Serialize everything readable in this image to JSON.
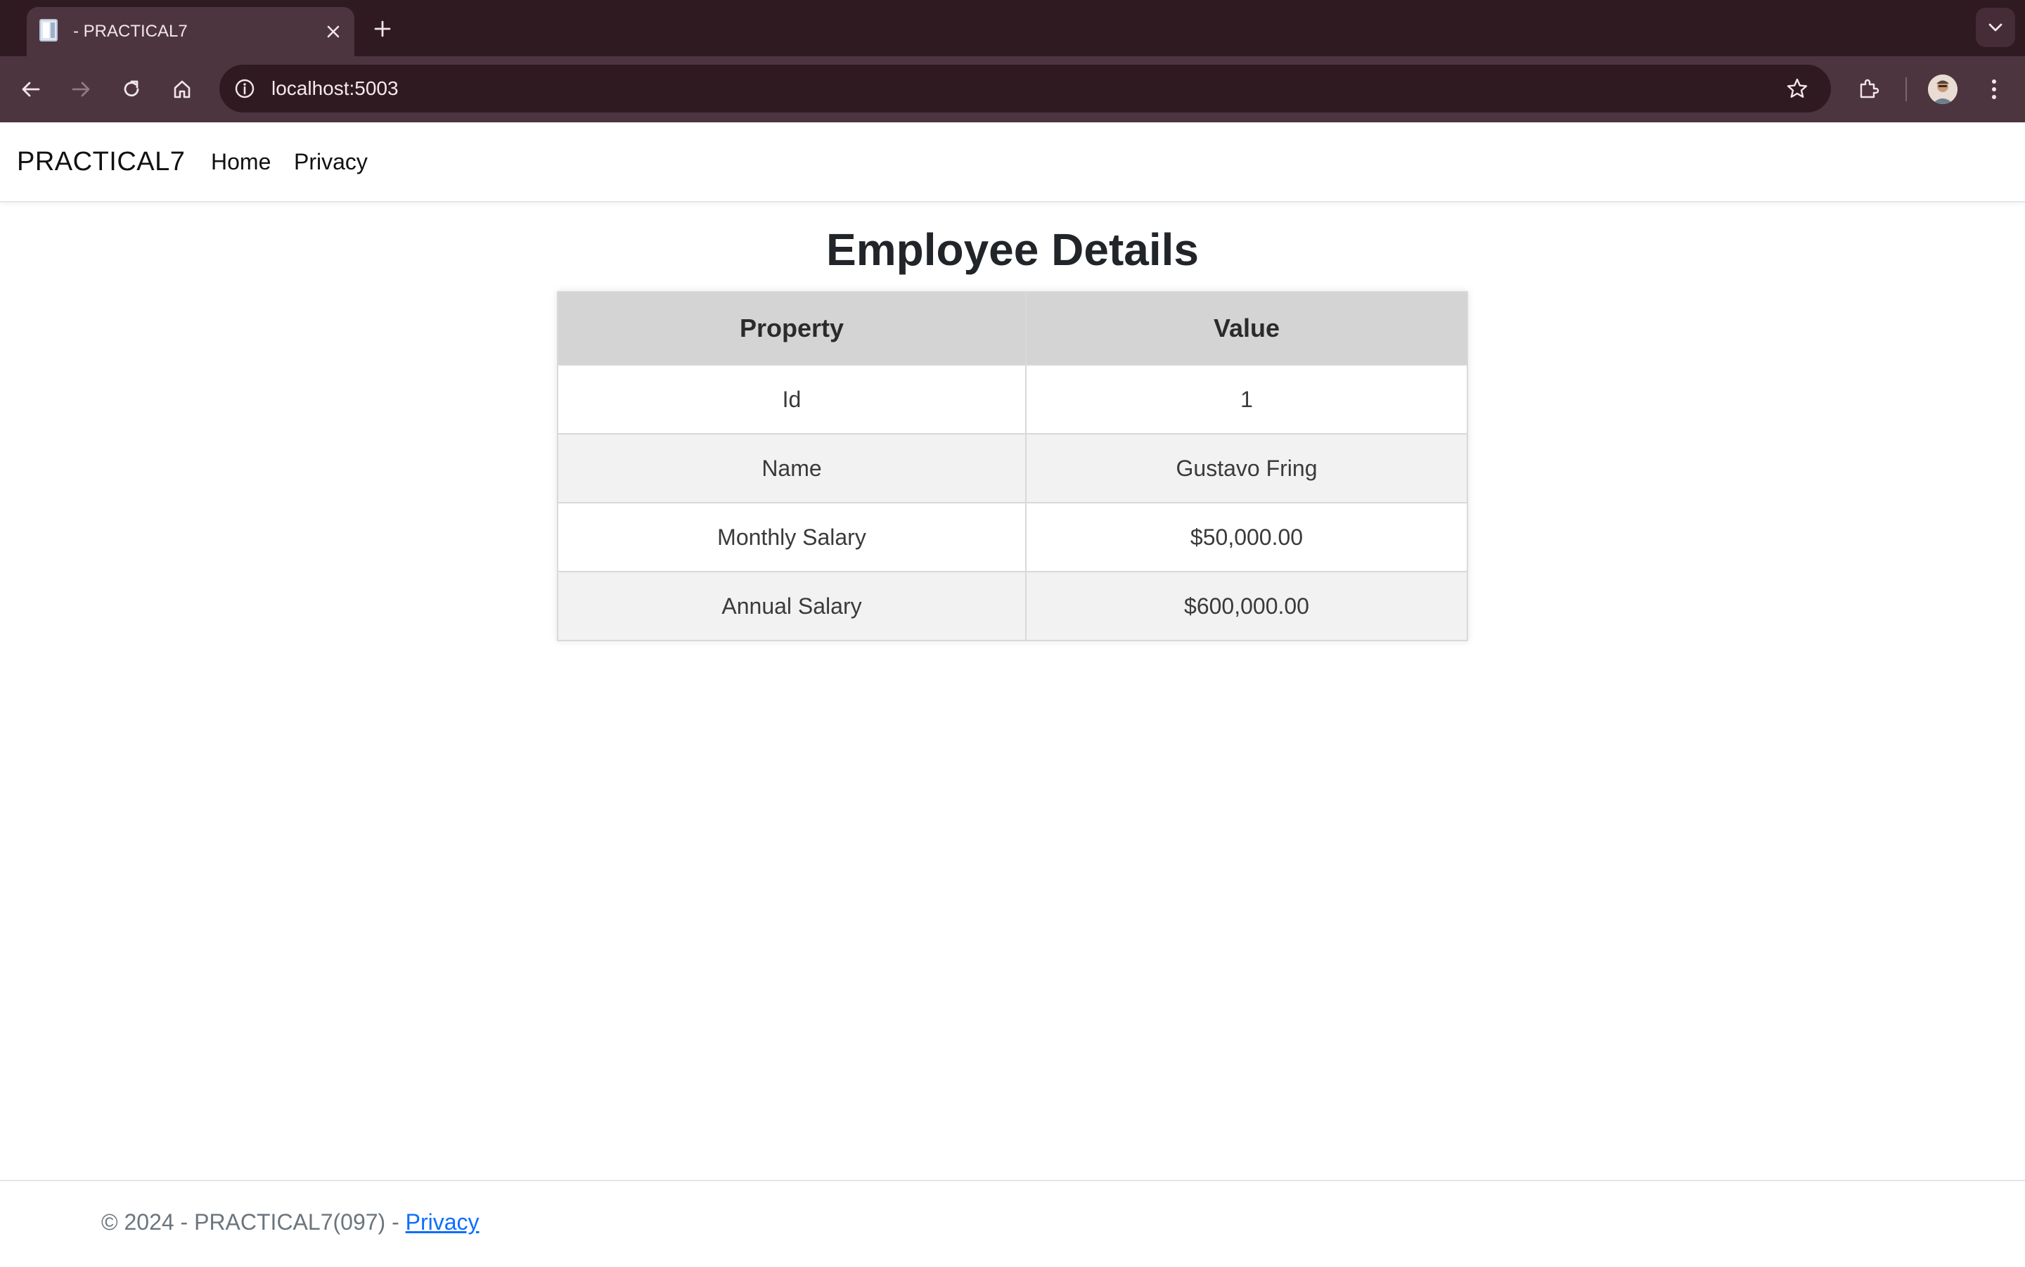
{
  "browser": {
    "tab_title": "- PRACTICAL7",
    "url": "localhost:5003",
    "icons": [
      "back-arrow-icon",
      "forward-arrow-icon",
      "reload-icon",
      "home-icon",
      "info-icon",
      "star-icon",
      "extensions-icon",
      "kebab-menu-icon"
    ]
  },
  "navbar": {
    "brand": "PRACTICAL7",
    "links": [
      "Home",
      "Privacy"
    ]
  },
  "main": {
    "title": "Employee Details",
    "table": {
      "headers": [
        "Property",
        "Value"
      ],
      "rows": [
        [
          "Id",
          "1"
        ],
        [
          "Name",
          "Gustavo Fring"
        ],
        [
          "Monthly Salary",
          "$50,000.00"
        ],
        [
          "Annual Salary",
          "$600,000.00"
        ]
      ]
    }
  },
  "footer": {
    "text": "© 2024 - PRACTICAL7(097) - ",
    "link": "Privacy"
  },
  "colors": {
    "chrome_dark": "#2f1a22",
    "chrome_toolbar": "#4d3540",
    "table_header": "#d4d4d4",
    "row_alt": "#f2f2f2",
    "link": "#0d6efd"
  }
}
